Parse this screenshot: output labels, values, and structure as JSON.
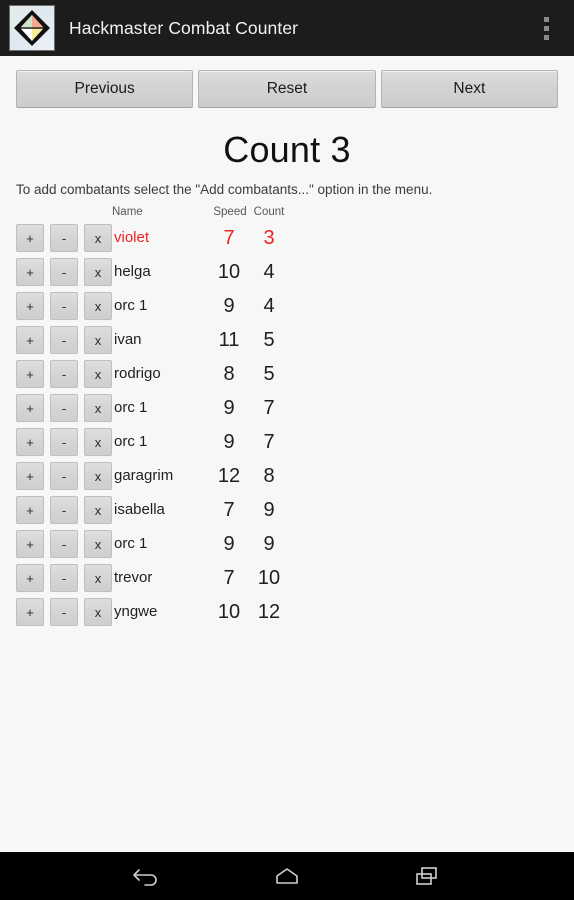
{
  "titlebar": {
    "app_title": "Hackmaster Combat Counter",
    "icon_name": "diamond-app-icon",
    "icon_colors": {
      "top": "#f2a98f",
      "left": "#cfe3c8",
      "right": "#f3ef9f",
      "bottom": "#ffffff",
      "outline": "#111111"
    },
    "overflow_label": "More options",
    "background": "#1c1c1c"
  },
  "toolbar": {
    "previous_label": "Previous",
    "reset_label": "Reset",
    "next_label": "Next"
  },
  "main": {
    "heading": "Count 3",
    "instructions": "To add combatants select the \"Add combatants...\" option in the menu.",
    "active_color": "#ee2222",
    "columns": {
      "name": "Name",
      "speed": "Speed",
      "count": "Count"
    },
    "row_controls": {
      "increment": "+",
      "decrement": "-",
      "remove": "x"
    },
    "rows": [
      {
        "name": "violet",
        "speed": "7",
        "count": "3",
        "active": true
      },
      {
        "name": "helga",
        "speed": "10",
        "count": "4",
        "active": false
      },
      {
        "name": "orc 1",
        "speed": "9",
        "count": "4",
        "active": false
      },
      {
        "name": "ivan",
        "speed": "11",
        "count": "5",
        "active": false
      },
      {
        "name": "rodrigo",
        "speed": "8",
        "count": "5",
        "active": false
      },
      {
        "name": "orc 1",
        "speed": "9",
        "count": "7",
        "active": false
      },
      {
        "name": "orc 1",
        "speed": "9",
        "count": "7",
        "active": false
      },
      {
        "name": "garagrim",
        "speed": "12",
        "count": "8",
        "active": false
      },
      {
        "name": "isabella",
        "speed": "7",
        "count": "9",
        "active": false
      },
      {
        "name": "orc 1",
        "speed": "9",
        "count": "9",
        "active": false
      },
      {
        "name": "trevor",
        "speed": "7",
        "count": "10",
        "active": false
      },
      {
        "name": "yngwe",
        "speed": "10",
        "count": "12",
        "active": false
      }
    ]
  },
  "system_nav": {
    "back_label": "Back",
    "home_label": "Home",
    "recents_label": "Recent apps"
  }
}
